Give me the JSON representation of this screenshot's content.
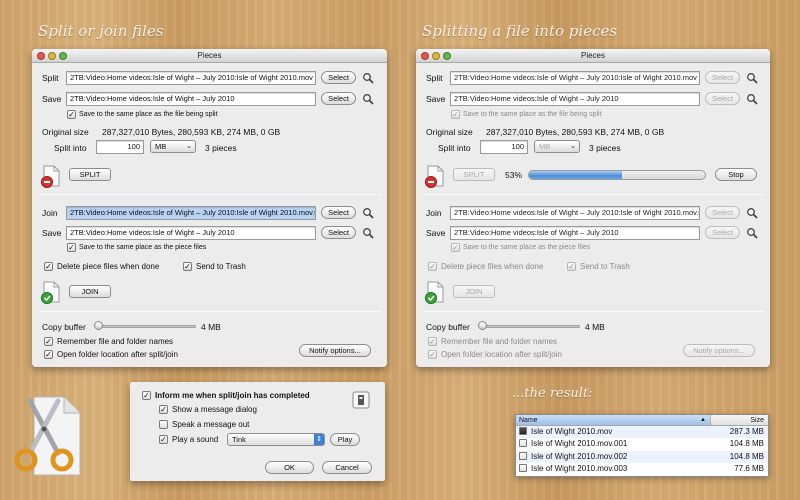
{
  "headings": {
    "left": "Split or join files",
    "right": "Splitting a file into pieces",
    "result": "...the result:"
  },
  "window_left": {
    "title": "Pieces",
    "split": {
      "label": "Split",
      "path": "2TB:Video:Home videos:Isle of Wight – July 2010:Isle of Wight 2010.mov",
      "select": "Select"
    },
    "save": {
      "label": "Save",
      "path": "2TB:Video:Home videos:Isle of Wight – July 2010",
      "select": "Select",
      "same_place": "Save to the same place as the file being split"
    },
    "original_size_label": "Original size",
    "original_size_value": "287,327,010 Bytes, 280,593 KB, 274 MB, 0 GB",
    "split_into_label": "Split into",
    "split_into_value": "100",
    "unit": "MB",
    "pieces": "3 pieces",
    "split_button": "SPLIT",
    "join": {
      "label": "Join",
      "path": "2TB:Video:Home videos:Isle of Wight – July 2010:Isle of Wight 2010.mov.0",
      "select": "Select"
    },
    "join_save": {
      "label": "Save",
      "path": "2TB:Video:Home videos:Isle of Wight – July 2010",
      "select": "Select",
      "same_place": "Save to the same place as the piece files"
    },
    "delete_pieces": "Delete piece files when done",
    "send_trash": "Send to Trash",
    "join_button": "JOIN",
    "copy_buffer_label": "Copy buffer",
    "copy_buffer_value": "4 MB",
    "remember": "Remember file and folder names",
    "open_folder": "Open folder location after split/join",
    "notify": "Notify options..."
  },
  "window_right": {
    "title": "Pieces",
    "split": {
      "label": "Split",
      "path": "2TB:Video:Home videos:Isle of Wight – July 2010:Isle of Wight 2010.mov",
      "select": "Select"
    },
    "save": {
      "label": "Save",
      "path": "2TB:Video:Home videos:Isle of Wight – July 2010",
      "select": "Select",
      "same_place": "Save to the same place as the file being split"
    },
    "original_size_label": "Original size",
    "original_size_value": "287,327,010 Bytes, 280,593 KB, 274 MB, 0 GB",
    "split_into_label": "Split into",
    "split_into_value": "100",
    "unit": "MB",
    "pieces": "3 pieces",
    "split_button": "SPLIT",
    "progress_text": "53%",
    "progress_fraction": 0.53,
    "stop": "Stop",
    "join": {
      "label": "Join",
      "path": "2TB:Video:Home videos:Isle of Wight – July 2010:Isle of Wight 2010.mov.001",
      "select": "Select"
    },
    "join_save": {
      "label": "Save",
      "path": "2TB:Video:Home videos:Isle of Wight – July 2010",
      "select": "Select",
      "same_place": "Save to the same place as the piece files"
    },
    "delete_pieces": "Delete piece files when done",
    "send_trash": "Send to Trash",
    "join_button": "JOIN",
    "copy_buffer_label": "Copy buffer",
    "copy_buffer_value": "4 MB",
    "remember": "Remember file and folder names",
    "open_folder": "Open folder location after split/join",
    "notify": "Notify options..."
  },
  "notify_sheet": {
    "inform": "Inform me when split/join has completed",
    "show_dialog": "Show a message dialog",
    "speak": "Speak a message out",
    "play_sound": "Play a sound",
    "sound": "Tink",
    "play": "Play",
    "ok": "OK",
    "cancel": "Cancel"
  },
  "finder": {
    "col_name": "Name",
    "col_size": "Size",
    "rows": [
      {
        "name": "Isle of Wight 2010.mov",
        "size": "287.3 MB"
      },
      {
        "name": "Isle of Wight 2010.mov.001",
        "size": "104.8 MB"
      },
      {
        "name": "Isle of Wight 2010.mov.002",
        "size": "104.8 MB"
      },
      {
        "name": "Isle of Wight 2010.mov.003",
        "size": "77.6 MB"
      }
    ]
  },
  "colors": {
    "progress": "#4d8fd8",
    "selected_field": "#b8d2f4",
    "join_badge": "#3aa53a",
    "split_badge": "#d9342b"
  }
}
